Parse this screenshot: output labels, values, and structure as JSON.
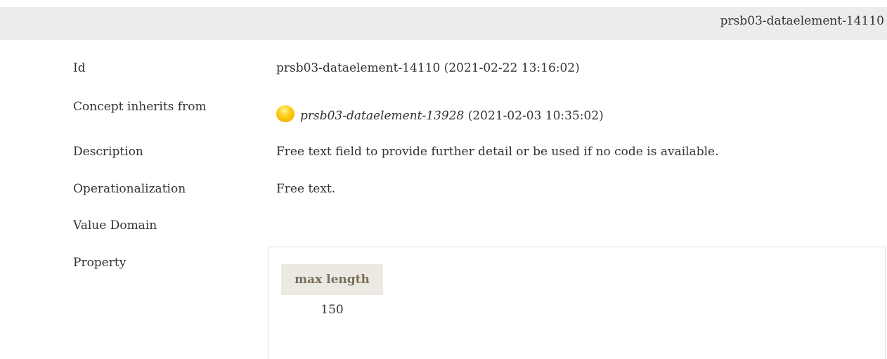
{
  "header": {
    "title": "prsb03-dataelement-14110"
  },
  "details": {
    "id_label": "Id",
    "id_value": "prsb03-dataelement-14110 (2021-02-22 13:16:02)",
    "inherits_label": "Concept inherits from",
    "inherits_id": "prsb03-dataelement-13928",
    "inherits_date": "(2021-02-03 10:35:02)",
    "inherits_status_icon": "status-circle-yellow",
    "description_label": "Description",
    "description_value": "Free text field to provide further detail or be used if no code is available.",
    "operationalization_label": "Operationalization",
    "operationalization_value": "Free text.",
    "value_domain_label": "Value Domain",
    "property_label": "Property"
  },
  "property_table": {
    "columns": [
      "max length"
    ],
    "rows": [
      [
        "150"
      ]
    ]
  },
  "colors": {
    "header_bg": "#ececec",
    "table_header_bg": "#ece9e2",
    "table_header_text": "#7a6f5c",
    "status_yellow": "#ffd21a"
  }
}
